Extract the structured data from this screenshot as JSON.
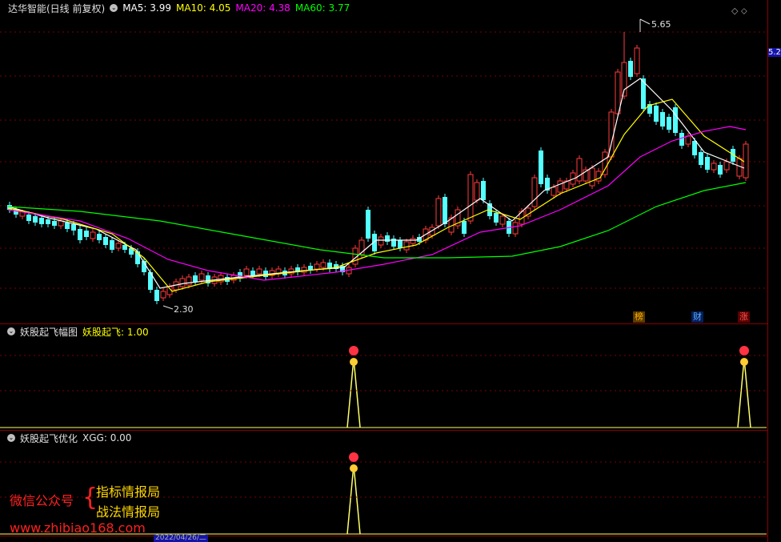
{
  "main": {
    "title": "达华智能(日线 前复权)",
    "ma5": "MA5: 3.99",
    "ma10": "MA10: 4.05",
    "ma20": "MA20: 4.38",
    "ma60": "MA60: 3.77",
    "high_label": "5.65",
    "low_label": "2.30",
    "right_price": "5.2",
    "tags": [
      "榜",
      "财",
      "涨"
    ],
    "colors": {
      "ma5": "#ffffff",
      "ma10": "#ffff00",
      "ma20": "#ff00ff",
      "ma60": "#00ff00",
      "up": "#ff3b3b",
      "down": "#54ffff"
    }
  },
  "sub1": {
    "title": "妖股起飞幅图",
    "value": "妖股起飞: 1.00"
  },
  "sub2": {
    "title": "妖股起飞优化",
    "value": "XGG: 0.00"
  },
  "promo": {
    "wechat": "微信公众号",
    "brace": "{",
    "line1": "指标情报局",
    "line2": "战法情报局",
    "url": "www.zhibiao168.com"
  },
  "bottom_axis": {
    "date": "2022/04/26/二"
  }
}
